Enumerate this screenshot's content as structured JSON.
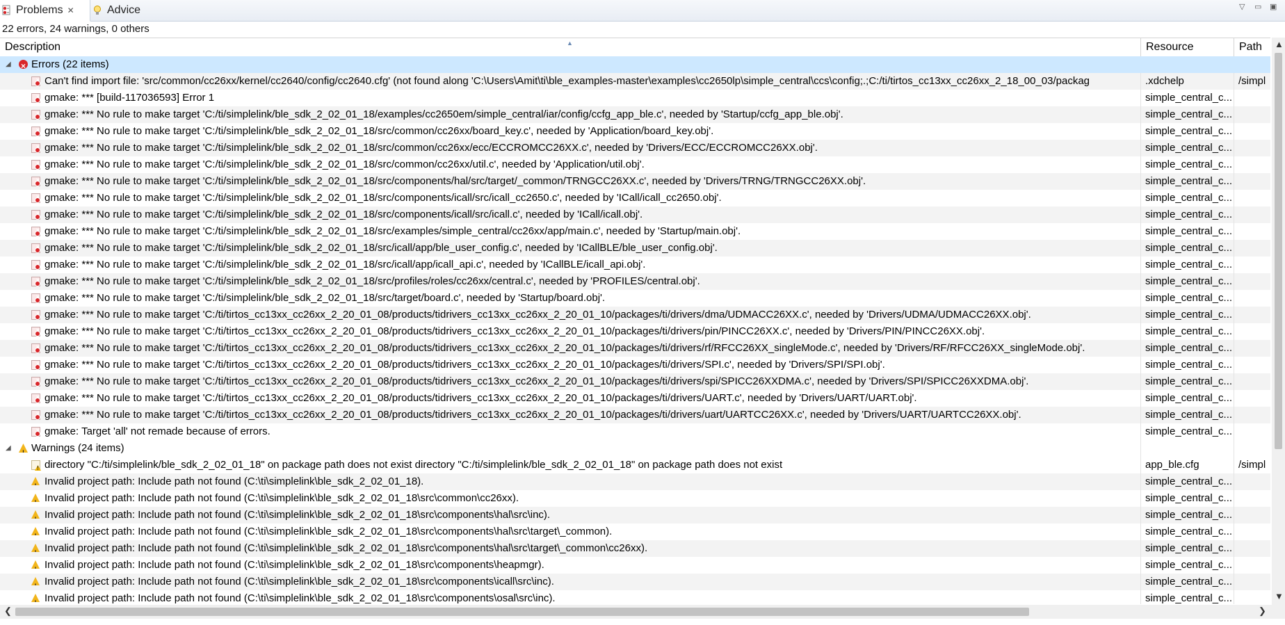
{
  "tabs": [
    {
      "label": "Problems",
      "icon": "problems-icon",
      "close": "✕"
    },
    {
      "label": "Advice",
      "icon": "lightbulb-icon"
    }
  ],
  "summary": "22 errors, 24 warnings, 0 others",
  "columns": {
    "description": "Description",
    "resource": "Resource",
    "path": "Path"
  },
  "groups": {
    "errors": {
      "label": "Errors (22 items)",
      "icon": "error-circle-icon"
    },
    "warnings": {
      "label": "Warnings (24 items)",
      "icon": "warning-triangle-icon"
    }
  },
  "error_rows": [
    {
      "desc": "Can't find import file: 'src/common/cc26xx/kernel/cc2640/config/cc2640.cfg' (not found along 'C:\\Users\\Amit\\ti\\ble_examples-master\\examples\\cc2650lp\\simple_central\\ccs\\config;.;C:/ti/tirtos_cc13xx_cc26xx_2_18_00_03/packag",
      "res": ".xdchelp",
      "path": "/simpl"
    },
    {
      "desc": "gmake: *** [build-117036593] Error 1",
      "res": "simple_central_c...",
      "path": ""
    },
    {
      "desc": "gmake: *** No rule to make target 'C:/ti/simplelink/ble_sdk_2_02_01_18/examples/cc2650em/simple_central/iar/config/ccfg_app_ble.c', needed by 'Startup/ccfg_app_ble.obj'.",
      "res": "simple_central_c...",
      "path": ""
    },
    {
      "desc": "gmake: *** No rule to make target 'C:/ti/simplelink/ble_sdk_2_02_01_18/src/common/cc26xx/board_key.c', needed by 'Application/board_key.obj'.",
      "res": "simple_central_c...",
      "path": ""
    },
    {
      "desc": "gmake: *** No rule to make target 'C:/ti/simplelink/ble_sdk_2_02_01_18/src/common/cc26xx/ecc/ECCROMCC26XX.c', needed by 'Drivers/ECC/ECCROMCC26XX.obj'.",
      "res": "simple_central_c...",
      "path": ""
    },
    {
      "desc": "gmake: *** No rule to make target 'C:/ti/simplelink/ble_sdk_2_02_01_18/src/common/cc26xx/util.c', needed by 'Application/util.obj'.",
      "res": "simple_central_c...",
      "path": ""
    },
    {
      "desc": "gmake: *** No rule to make target 'C:/ti/simplelink/ble_sdk_2_02_01_18/src/components/hal/src/target/_common/TRNGCC26XX.c', needed by 'Drivers/TRNG/TRNGCC26XX.obj'.",
      "res": "simple_central_c...",
      "path": ""
    },
    {
      "desc": "gmake: *** No rule to make target 'C:/ti/simplelink/ble_sdk_2_02_01_18/src/components/icall/src/icall_cc2650.c', needed by 'ICall/icall_cc2650.obj'.",
      "res": "simple_central_c...",
      "path": ""
    },
    {
      "desc": "gmake: *** No rule to make target 'C:/ti/simplelink/ble_sdk_2_02_01_18/src/components/icall/src/icall.c', needed by 'ICall/icall.obj'.",
      "res": "simple_central_c...",
      "path": ""
    },
    {
      "desc": "gmake: *** No rule to make target 'C:/ti/simplelink/ble_sdk_2_02_01_18/src/examples/simple_central/cc26xx/app/main.c', needed by 'Startup/main.obj'.",
      "res": "simple_central_c...",
      "path": ""
    },
    {
      "desc": "gmake: *** No rule to make target 'C:/ti/simplelink/ble_sdk_2_02_01_18/src/icall/app/ble_user_config.c', needed by 'ICallBLE/ble_user_config.obj'.",
      "res": "simple_central_c...",
      "path": ""
    },
    {
      "desc": "gmake: *** No rule to make target 'C:/ti/simplelink/ble_sdk_2_02_01_18/src/icall/app/icall_api.c', needed by 'ICallBLE/icall_api.obj'.",
      "res": "simple_central_c...",
      "path": ""
    },
    {
      "desc": "gmake: *** No rule to make target 'C:/ti/simplelink/ble_sdk_2_02_01_18/src/profiles/roles/cc26xx/central.c', needed by 'PROFILES/central.obj'.",
      "res": "simple_central_c...",
      "path": ""
    },
    {
      "desc": "gmake: *** No rule to make target 'C:/ti/simplelink/ble_sdk_2_02_01_18/src/target/board.c', needed by 'Startup/board.obj'.",
      "res": "simple_central_c...",
      "path": ""
    },
    {
      "desc": "gmake: *** No rule to make target 'C:/ti/tirtos_cc13xx_cc26xx_2_20_01_08/products/tidrivers_cc13xx_cc26xx_2_20_01_10/packages/ti/drivers/dma/UDMACC26XX.c', needed by 'Drivers/UDMA/UDMACC26XX.obj'.",
      "res": "simple_central_c...",
      "path": ""
    },
    {
      "desc": "gmake: *** No rule to make target 'C:/ti/tirtos_cc13xx_cc26xx_2_20_01_08/products/tidrivers_cc13xx_cc26xx_2_20_01_10/packages/ti/drivers/pin/PINCC26XX.c', needed by 'Drivers/PIN/PINCC26XX.obj'.",
      "res": "simple_central_c...",
      "path": ""
    },
    {
      "desc": "gmake: *** No rule to make target 'C:/ti/tirtos_cc13xx_cc26xx_2_20_01_08/products/tidrivers_cc13xx_cc26xx_2_20_01_10/packages/ti/drivers/rf/RFCC26XX_singleMode.c', needed by 'Drivers/RF/RFCC26XX_singleMode.obj'.",
      "res": "simple_central_c...",
      "path": ""
    },
    {
      "desc": "gmake: *** No rule to make target 'C:/ti/tirtos_cc13xx_cc26xx_2_20_01_08/products/tidrivers_cc13xx_cc26xx_2_20_01_10/packages/ti/drivers/SPI.c', needed by 'Drivers/SPI/SPI.obj'.",
      "res": "simple_central_c...",
      "path": ""
    },
    {
      "desc": "gmake: *** No rule to make target 'C:/ti/tirtos_cc13xx_cc26xx_2_20_01_08/products/tidrivers_cc13xx_cc26xx_2_20_01_10/packages/ti/drivers/spi/SPICC26XXDMA.c', needed by 'Drivers/SPI/SPICC26XXDMA.obj'.",
      "res": "simple_central_c...",
      "path": ""
    },
    {
      "desc": "gmake: *** No rule to make target 'C:/ti/tirtos_cc13xx_cc26xx_2_20_01_08/products/tidrivers_cc13xx_cc26xx_2_20_01_10/packages/ti/drivers/UART.c', needed by 'Drivers/UART/UART.obj'.",
      "res": "simple_central_c...",
      "path": ""
    },
    {
      "desc": "gmake: *** No rule to make target 'C:/ti/tirtos_cc13xx_cc26xx_2_20_01_08/products/tidrivers_cc13xx_cc26xx_2_20_01_10/packages/ti/drivers/uart/UARTCC26XX.c', needed by 'Drivers/UART/UARTCC26XX.obj'.",
      "res": "simple_central_c...",
      "path": ""
    },
    {
      "desc": "gmake: Target 'all' not remade because of errors.",
      "res": "simple_central_c...",
      "path": ""
    }
  ],
  "warning_rows": [
    {
      "desc": "directory \"C:/ti/simplelink/ble_sdk_2_02_01_18\" on package path does not exist directory \"C:/ti/simplelink/ble_sdk_2_02_01_18\" on package path does not exist",
      "res": "app_ble.cfg",
      "path": "/simpl",
      "icon": "file-warning-icon"
    },
    {
      "desc": "Invalid project path: Include path not found (C:\\ti\\simplelink\\ble_sdk_2_02_01_18).",
      "res": "simple_central_c...",
      "path": "",
      "icon": "warning-icon"
    },
    {
      "desc": "Invalid project path: Include path not found (C:\\ti\\simplelink\\ble_sdk_2_02_01_18\\src\\common\\cc26xx).",
      "res": "simple_central_c...",
      "path": "",
      "icon": "warning-icon"
    },
    {
      "desc": "Invalid project path: Include path not found (C:\\ti\\simplelink\\ble_sdk_2_02_01_18\\src\\components\\hal\\src\\inc).",
      "res": "simple_central_c...",
      "path": "",
      "icon": "warning-icon"
    },
    {
      "desc": "Invalid project path: Include path not found (C:\\ti\\simplelink\\ble_sdk_2_02_01_18\\src\\components\\hal\\src\\target\\_common).",
      "res": "simple_central_c...",
      "path": "",
      "icon": "warning-icon"
    },
    {
      "desc": "Invalid project path: Include path not found (C:\\ti\\simplelink\\ble_sdk_2_02_01_18\\src\\components\\hal\\src\\target\\_common\\cc26xx).",
      "res": "simple_central_c...",
      "path": "",
      "icon": "warning-icon"
    },
    {
      "desc": "Invalid project path: Include path not found (C:\\ti\\simplelink\\ble_sdk_2_02_01_18\\src\\components\\heapmgr).",
      "res": "simple_central_c...",
      "path": "",
      "icon": "warning-icon"
    },
    {
      "desc": "Invalid project path: Include path not found (C:\\ti\\simplelink\\ble_sdk_2_02_01_18\\src\\components\\icall\\src\\inc).",
      "res": "simple_central_c...",
      "path": "",
      "icon": "warning-icon"
    },
    {
      "desc": "Invalid project path: Include path not found (C:\\ti\\simplelink\\ble_sdk_2_02_01_18\\src\\components\\osal\\src\\inc).",
      "res": "simple_central_c...",
      "path": "",
      "icon": "warning-icon"
    }
  ],
  "colors": {
    "selection": "#cde8ff",
    "error": "#d9262a",
    "warning": "#f2b51b"
  }
}
